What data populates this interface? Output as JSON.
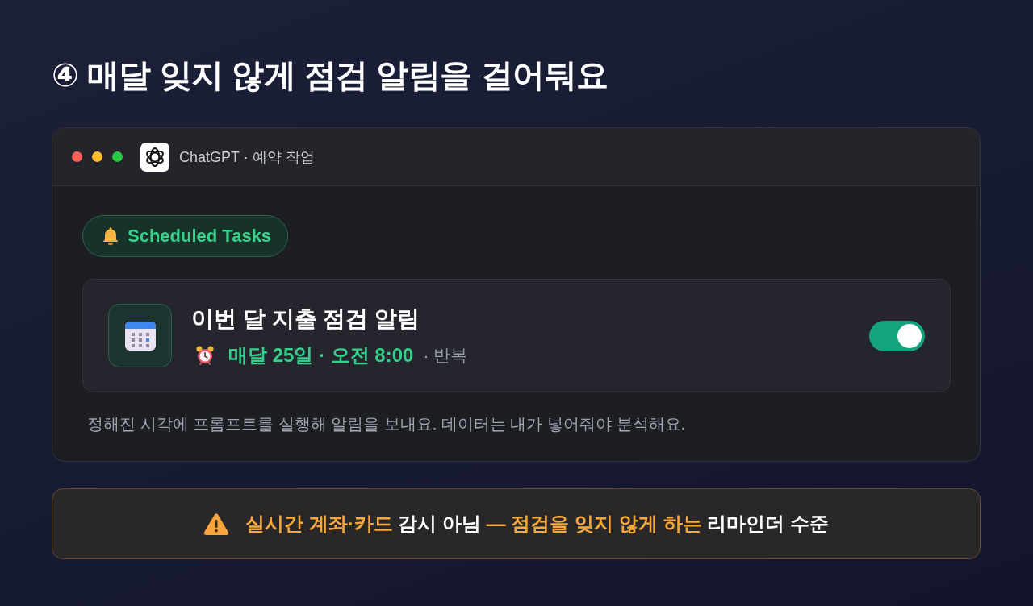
{
  "page_title": "④ 매달 잊지 않게 점검 알림을 걸어둬요",
  "window": {
    "title": "ChatGPT · 예약 작업"
  },
  "badge": {
    "label": "Scheduled Tasks"
  },
  "task": {
    "title": "이번 달 지출 점검 알림",
    "schedule": "매달 25일 · 오전 8:00",
    "recurrence": "· 반복",
    "enabled": true
  },
  "description": "정해진 시각에 프롬프트를 실행해 알림을 보내요. 데이터는 내가 넣어줘야 분석해요.",
  "notice": {
    "segments": [
      {
        "text": "실시간 계좌·카드",
        "highlight": true
      },
      {
        "text": " 감시 아님 ",
        "highlight": false
      },
      {
        "text": "— 점검을 잊지 않게 하는",
        "highlight": true
      },
      {
        "text": " 리마인더 수준",
        "highlight": false
      }
    ]
  }
}
